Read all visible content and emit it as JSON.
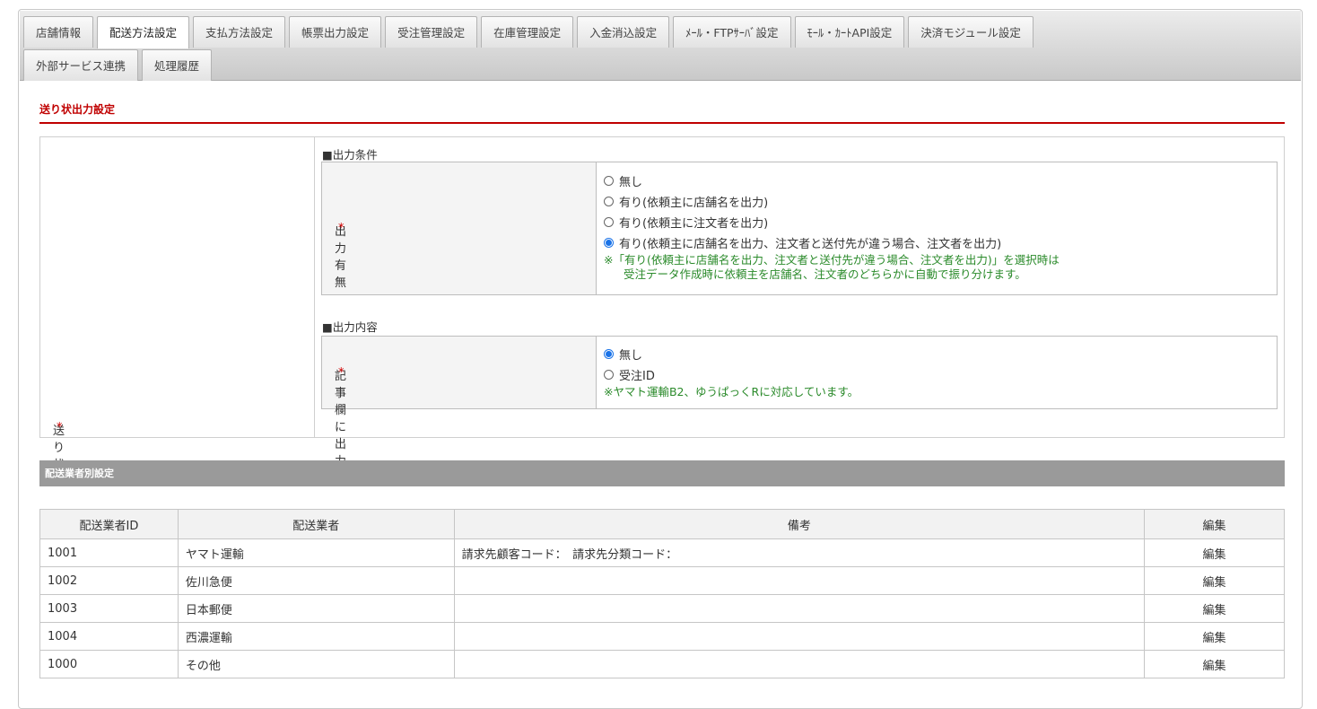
{
  "tabs": {
    "row1": [
      "店舗情報",
      "配送方法設定",
      "支払方法設定",
      "帳票出力設定",
      "受注管理設定",
      "在庫管理設定",
      "入金消込設定",
      "ﾒｰﾙ・FTPｻｰﾊﾞ設定",
      "ﾓｰﾙ・ｶｰﾄAPI設定",
      "決済モジュール設定"
    ],
    "row2": [
      "外部サービス連携",
      "処理履歴"
    ],
    "active": "配送方法設定"
  },
  "section": {
    "title": "送り状出力設定"
  },
  "invoice": {
    "label": "送り状",
    "required_mark": "*",
    "output_condition": {
      "heading": "■出力条件",
      "label": "出力有無",
      "options": [
        {
          "label": "無し",
          "checked": false
        },
        {
          "label": "有り(依頼主に店舗名を出力)",
          "checked": false
        },
        {
          "label": "有り(依頼主に注文者を出力)",
          "checked": false
        },
        {
          "label": "有り(依頼主に店舗名を出力、注文者と送付先が違う場合、注文者を出力)",
          "checked": true
        }
      ],
      "note_line1": "※「有り(依頼主に店舗名を出力、注文者と送付先が違う場合、注文者を出力)」を選択時は",
      "note_line2": "受注データ作成時に依頼主を店舗名、注文者のどちらかに自動で振り分けます。"
    },
    "output_content": {
      "heading": "■出力内容",
      "label": "記事欄に出力",
      "options": [
        {
          "label": "無し",
          "checked": true
        },
        {
          "label": "受注ID",
          "checked": false
        }
      ],
      "note": "※ヤマト運輸B2、ゆうぱっくRに対応しています。"
    }
  },
  "carrier_settings": {
    "band_title": "配送業者別設定",
    "headers": [
      "配送業者ID",
      "配送業者",
      "備考",
      "編集"
    ],
    "rows": [
      {
        "id": "1001",
        "name": "ヤマト運輸",
        "note": "請求先顧客コード：　請求先分類コード：",
        "edit": "編集"
      },
      {
        "id": "1002",
        "name": "佐川急便",
        "note": "",
        "edit": "編集"
      },
      {
        "id": "1003",
        "name": "日本郵便",
        "note": "",
        "edit": "編集"
      },
      {
        "id": "1004",
        "name": "西濃運輸",
        "note": "",
        "edit": "編集"
      },
      {
        "id": "1000",
        "name": "その他",
        "note": "",
        "edit": "編集"
      }
    ]
  },
  "colors": {
    "accent": "#c00000",
    "note": "#2a8a2a",
    "radio": "#1a73e8",
    "band": "#9a9a9a"
  }
}
